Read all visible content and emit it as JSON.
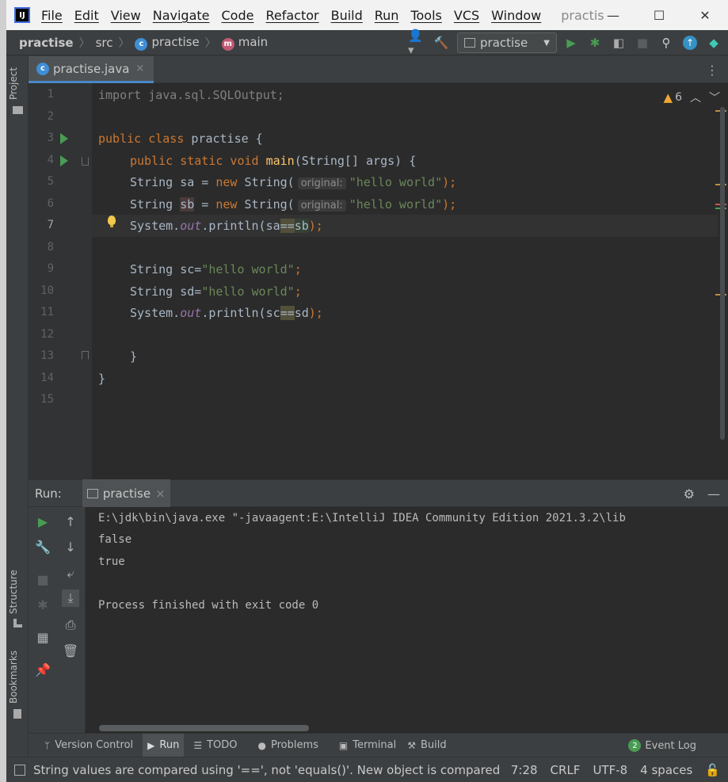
{
  "app": {
    "logo": "IJ",
    "project_title": "practis"
  },
  "menu": [
    "File",
    "Edit",
    "View",
    "Navigate",
    "Code",
    "Refactor",
    "Build",
    "Run",
    "Tools",
    "VCS",
    "Window"
  ],
  "window_controls": {
    "minimize": "—",
    "maximize": "☐",
    "close": "✕"
  },
  "breadcrumb": {
    "project": "practise",
    "folder": "src",
    "class": "practise",
    "method": "main"
  },
  "run_config": {
    "label": "practise"
  },
  "left_strip": {
    "project": "Project",
    "structure": "Structure",
    "bookmarks": "Bookmarks"
  },
  "editor": {
    "tab": {
      "label": "practise.java",
      "close": "×"
    },
    "warnings": {
      "count": "6"
    },
    "line_numbers": [
      "1",
      "2",
      "3",
      "4",
      "5",
      "6",
      "7",
      "8",
      "9",
      "10",
      "11",
      "12",
      "13",
      "14",
      "15"
    ],
    "current_line": "7",
    "code": {
      "l1": "import java.sql.SQLOutput;",
      "l3_kw": "public class ",
      "l3_name": "practise",
      "l3_rest": " {",
      "l4_kw": "public static void ",
      "l4_fn": "main",
      "l4_rest": "(String[] args) {",
      "l5_a": "String sa = ",
      "l5_new": "new ",
      "l5_str": "String(",
      "l5_hint": "original:",
      "l5_lit": "\"hello world\"",
      "l5_end": ");",
      "l6_a": "String ",
      "l6_var": "sb",
      "l6_b": " = ",
      "l6_new": "new ",
      "l6_str": "String(",
      "l6_hint": "original:",
      "l6_lit": "\"hello world\"",
      "l6_end": ");",
      "l7_a": "System.",
      "l7_out": "out",
      "l7_b": ".println(sa",
      "l7_op": "==",
      "l7_c": "sb",
      "l7_end": ");",
      "l9_a": "String sc=",
      "l9_lit": "\"hello world\"",
      "l9_end": ";",
      "l10_a": "String sd=",
      "l10_lit": "\"hello world\"",
      "l10_end": ";",
      "l11_a": "System.",
      "l11_out": "out",
      "l11_b": ".println(sc",
      "l11_op": "==",
      "l11_c": "sd",
      "l11_end": ");",
      "l13": "}",
      "l14": "}"
    }
  },
  "run_panel": {
    "title": "Run:",
    "tab_label": "practise",
    "tab_close": "×",
    "console": [
      "E:\\jdk\\bin\\java.exe \"-javaagent:E:\\IntelliJ IDEA Community Edition 2021.3.2\\lib",
      "false",
      "true",
      "",
      "Process finished with exit code 0"
    ]
  },
  "bottom_tools": [
    "Version Control",
    "Run",
    "TODO",
    "Problems",
    "Terminal",
    "Build"
  ],
  "event_log": {
    "label": "Event Log",
    "count": "2"
  },
  "status": {
    "message": "String values are compared using '==', not 'equals()'. New object is compared",
    "position": "7:28",
    "line_sep": "CRLF",
    "encoding": "UTF-8",
    "indent": "4 spaces"
  },
  "colors": {
    "keyword": "#cc7832",
    "function": "#ffc66d",
    "string": "#6a8759",
    "run_green": "#499c54",
    "accent": "#4a88c7"
  }
}
